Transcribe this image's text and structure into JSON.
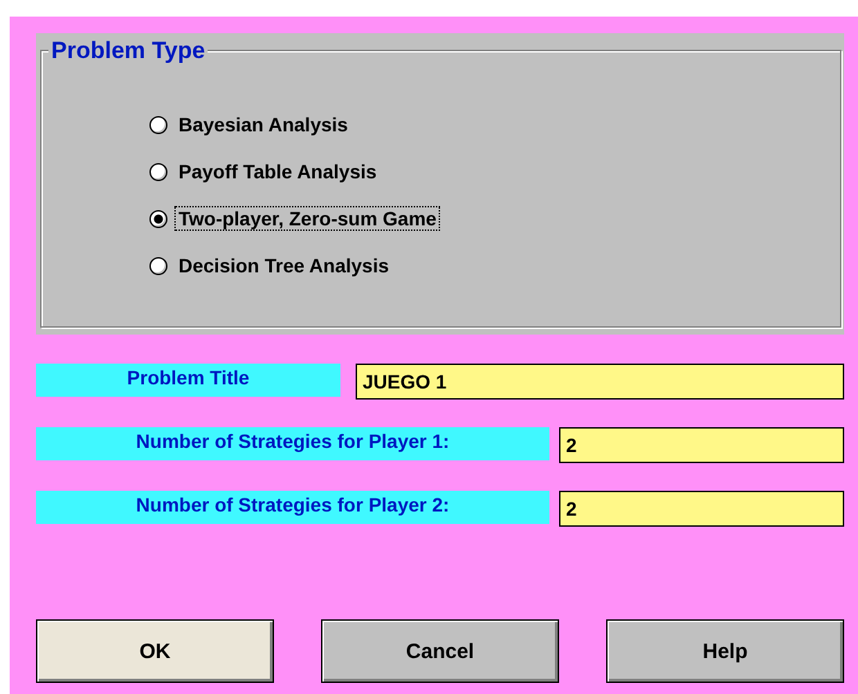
{
  "group": {
    "title": "Problem Type",
    "options": [
      {
        "label": "Bayesian Analysis",
        "selected": false
      },
      {
        "label": "Payoff Table Analysis",
        "selected": false
      },
      {
        "label": "Two-player, Zero-sum Game",
        "selected": true
      },
      {
        "label": "Decision Tree Analysis",
        "selected": false
      }
    ]
  },
  "fields": [
    {
      "kind": "wide",
      "label": "Problem Title",
      "value": "JUEGO 1"
    },
    {
      "kind": "narrow",
      "label": "Number of Strategies for Player 1:",
      "value": "2"
    },
    {
      "kind": "narrow",
      "label": "Number of Strategies for Player 2:",
      "value": "2"
    }
  ],
  "buttons": [
    {
      "label": "OK",
      "default": true
    },
    {
      "label": "Cancel",
      "default": false
    },
    {
      "label": "Help",
      "default": false
    }
  ]
}
